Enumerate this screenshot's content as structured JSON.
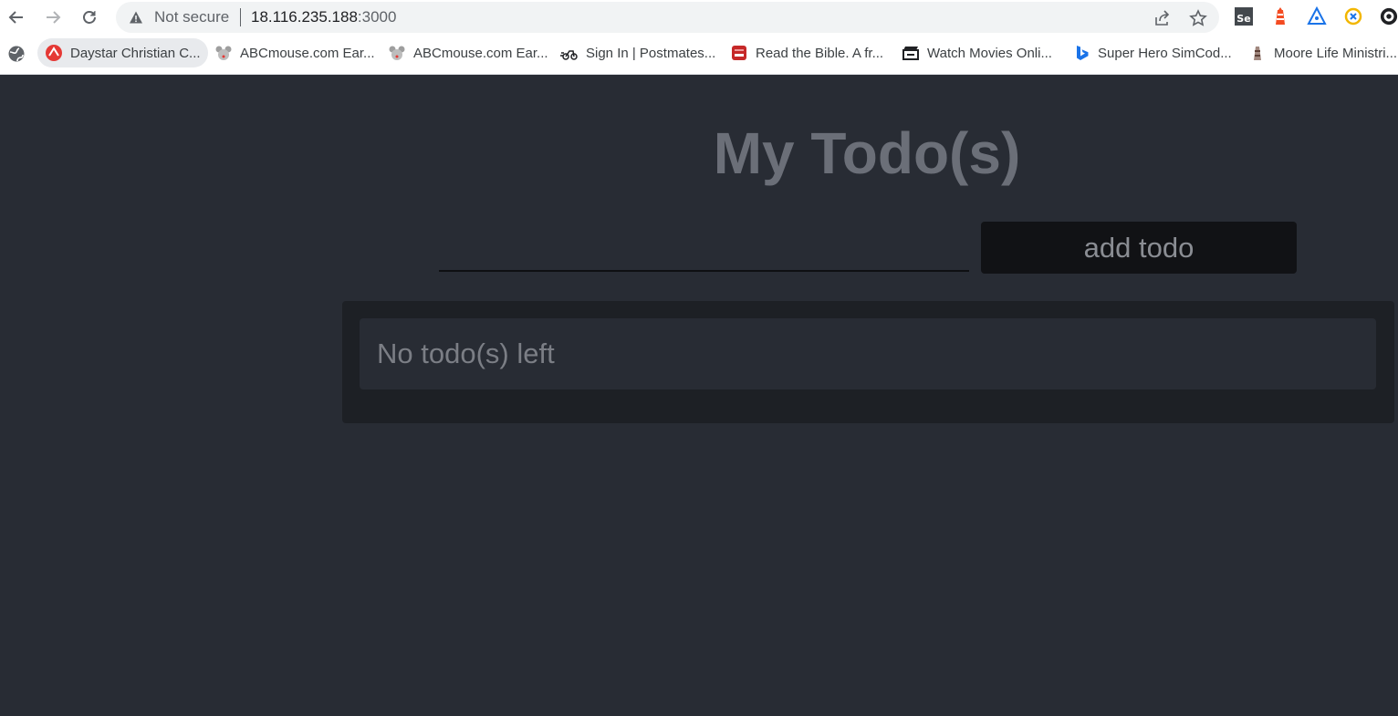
{
  "browser": {
    "security_label": "Not secure",
    "url_host": "18.116.235.188",
    "url_port": ":3000",
    "bookmarks": [
      {
        "label": "Daystar Christian C..."
      },
      {
        "label": "ABCmouse.com Ear..."
      },
      {
        "label": "ABCmouse.com Ear..."
      },
      {
        "label": "Sign In | Postmates..."
      },
      {
        "label": "Read the Bible. A fr..."
      },
      {
        "label": "Watch Movies Onli..."
      },
      {
        "label": "Super Hero SimCod..."
      },
      {
        "label": "Moore Life Ministri..."
      }
    ],
    "extension_se_label": "Se"
  },
  "app": {
    "title": "My Todo(s)",
    "input": {
      "value": "",
      "placeholder": ""
    },
    "add_button_label": "add todo",
    "empty_message": "No todo(s) left"
  },
  "colors": {
    "page_background": "#282c34",
    "panel_background": "#1d2025",
    "button_background": "#111215",
    "title_color": "#6b6f78"
  }
}
